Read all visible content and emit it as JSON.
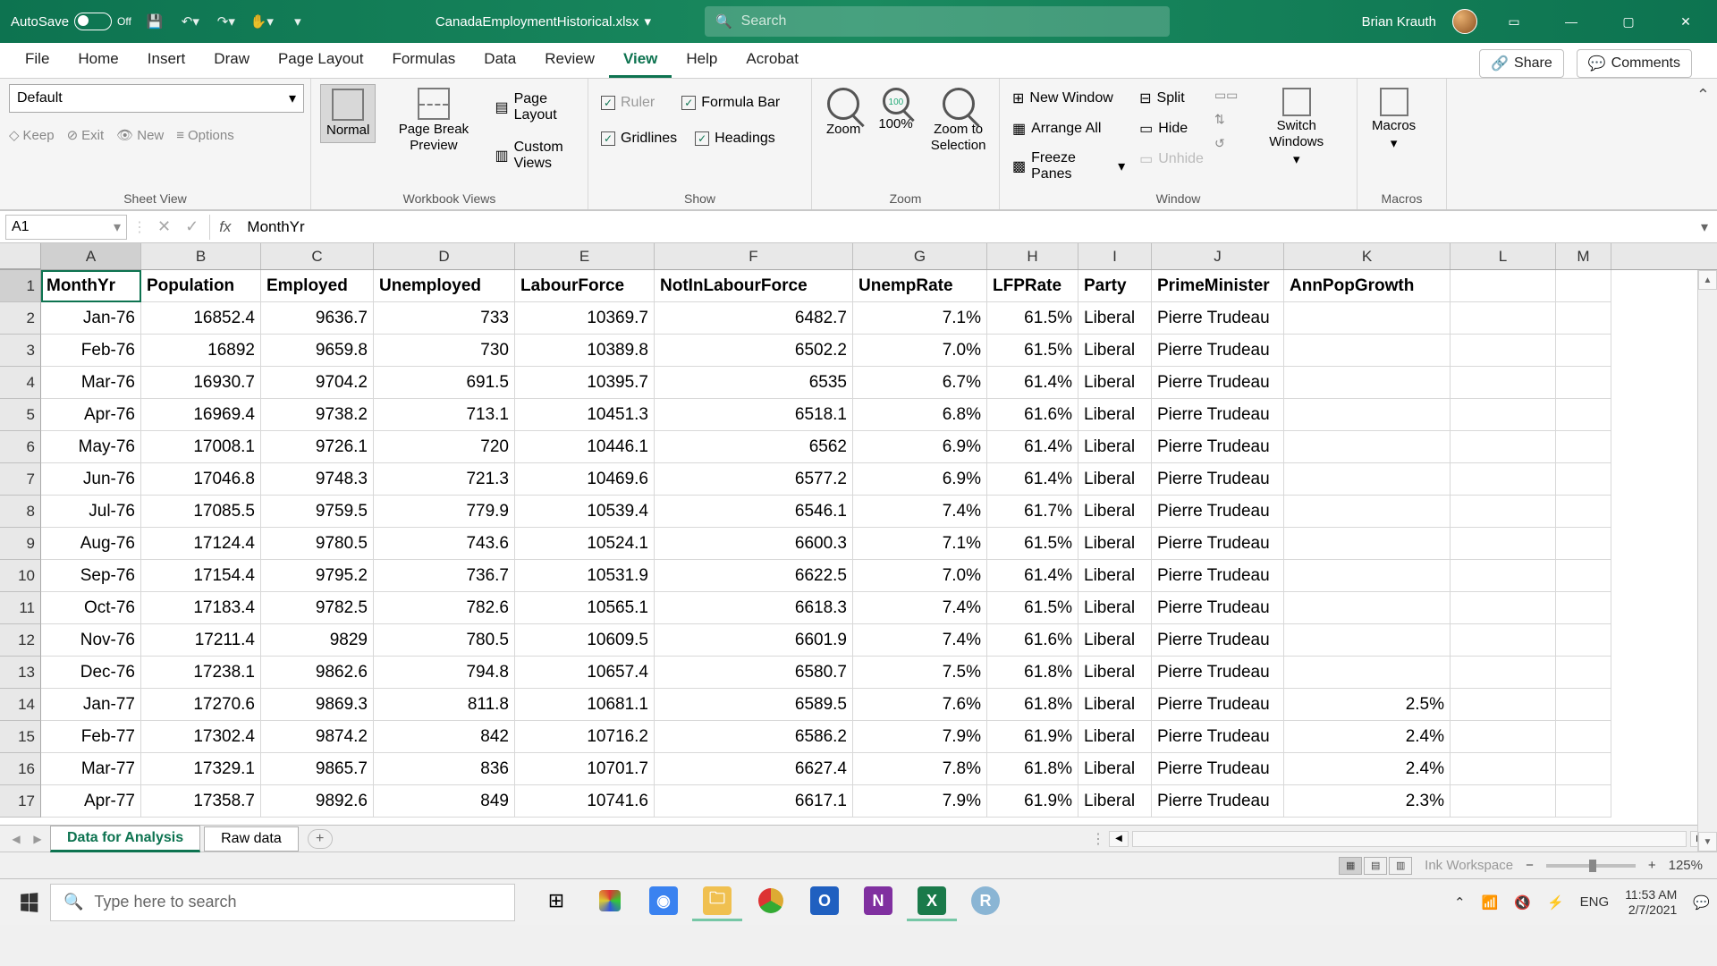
{
  "title_bar": {
    "autosave_label": "AutoSave",
    "autosave_state": "Off",
    "filename": "CanadaEmploymentHistorical.xlsx",
    "search_placeholder": "Search",
    "username": "Brian Krauth"
  },
  "ribbon_tabs": [
    "File",
    "Home",
    "Insert",
    "Draw",
    "Page Layout",
    "Formulas",
    "Data",
    "Review",
    "View",
    "Help",
    "Acrobat"
  ],
  "active_tab": "View",
  "ribbon_right": {
    "share": "Share",
    "comments": "Comments"
  },
  "ribbon": {
    "sheet_view": {
      "default": "Default",
      "keep": "Keep",
      "exit": "Exit",
      "new": "New",
      "options": "Options",
      "label": "Sheet View"
    },
    "workbook_views": {
      "normal": "Normal",
      "page_break": "Page Break Preview",
      "page_layout": "Page Layout",
      "custom": "Custom Views",
      "label": "Workbook Views"
    },
    "show": {
      "ruler": "Ruler",
      "formula_bar": "Formula Bar",
      "gridlines": "Gridlines",
      "headings": "Headings",
      "label": "Show"
    },
    "zoom": {
      "zoom": "Zoom",
      "hundred": "100%",
      "selection": "Zoom to Selection",
      "label": "Zoom"
    },
    "window": {
      "new_window": "New Window",
      "arrange": "Arrange All",
      "freeze": "Freeze Panes",
      "split": "Split",
      "hide": "Hide",
      "unhide": "Unhide",
      "switch": "Switch Windows",
      "label": "Window"
    },
    "macros": {
      "macros": "Macros",
      "label": "Macros"
    }
  },
  "formula_bar": {
    "name_box": "A1",
    "formula": "MonthYr"
  },
  "columns": [
    "A",
    "B",
    "C",
    "D",
    "E",
    "F",
    "G",
    "H",
    "I",
    "J",
    "K",
    "L",
    "M"
  ],
  "headers": [
    "MonthYr",
    "Population",
    "Employed",
    "Unemployed",
    "LabourForce",
    "NotInLabourForce",
    "UnempRate",
    "LFPRate",
    "Party",
    "PrimeMinister",
    "AnnPopGrowth",
    "",
    ""
  ],
  "rows": [
    [
      "Jan-76",
      "16852.4",
      "9636.7",
      "733",
      "10369.7",
      "6482.7",
      "7.1%",
      "61.5%",
      "Liberal",
      "Pierre Trudeau",
      "",
      "",
      ""
    ],
    [
      "Feb-76",
      "16892",
      "9659.8",
      "730",
      "10389.8",
      "6502.2",
      "7.0%",
      "61.5%",
      "Liberal",
      "Pierre Trudeau",
      "",
      "",
      ""
    ],
    [
      "Mar-76",
      "16930.7",
      "9704.2",
      "691.5",
      "10395.7",
      "6535",
      "6.7%",
      "61.4%",
      "Liberal",
      "Pierre Trudeau",
      "",
      "",
      ""
    ],
    [
      "Apr-76",
      "16969.4",
      "9738.2",
      "713.1",
      "10451.3",
      "6518.1",
      "6.8%",
      "61.6%",
      "Liberal",
      "Pierre Trudeau",
      "",
      "",
      ""
    ],
    [
      "May-76",
      "17008.1",
      "9726.1",
      "720",
      "10446.1",
      "6562",
      "6.9%",
      "61.4%",
      "Liberal",
      "Pierre Trudeau",
      "",
      "",
      ""
    ],
    [
      "Jun-76",
      "17046.8",
      "9748.3",
      "721.3",
      "10469.6",
      "6577.2",
      "6.9%",
      "61.4%",
      "Liberal",
      "Pierre Trudeau",
      "",
      "",
      ""
    ],
    [
      "Jul-76",
      "17085.5",
      "9759.5",
      "779.9",
      "10539.4",
      "6546.1",
      "7.4%",
      "61.7%",
      "Liberal",
      "Pierre Trudeau",
      "",
      "",
      ""
    ],
    [
      "Aug-76",
      "17124.4",
      "9780.5",
      "743.6",
      "10524.1",
      "6600.3",
      "7.1%",
      "61.5%",
      "Liberal",
      "Pierre Trudeau",
      "",
      "",
      ""
    ],
    [
      "Sep-76",
      "17154.4",
      "9795.2",
      "736.7",
      "10531.9",
      "6622.5",
      "7.0%",
      "61.4%",
      "Liberal",
      "Pierre Trudeau",
      "",
      "",
      ""
    ],
    [
      "Oct-76",
      "17183.4",
      "9782.5",
      "782.6",
      "10565.1",
      "6618.3",
      "7.4%",
      "61.5%",
      "Liberal",
      "Pierre Trudeau",
      "",
      "",
      ""
    ],
    [
      "Nov-76",
      "17211.4",
      "9829",
      "780.5",
      "10609.5",
      "6601.9",
      "7.4%",
      "61.6%",
      "Liberal",
      "Pierre Trudeau",
      "",
      "",
      ""
    ],
    [
      "Dec-76",
      "17238.1",
      "9862.6",
      "794.8",
      "10657.4",
      "6580.7",
      "7.5%",
      "61.8%",
      "Liberal",
      "Pierre Trudeau",
      "",
      "",
      ""
    ],
    [
      "Jan-77",
      "17270.6",
      "9869.3",
      "811.8",
      "10681.1",
      "6589.5",
      "7.6%",
      "61.8%",
      "Liberal",
      "Pierre Trudeau",
      "2.5%",
      "",
      ""
    ],
    [
      "Feb-77",
      "17302.4",
      "9874.2",
      "842",
      "10716.2",
      "6586.2",
      "7.9%",
      "61.9%",
      "Liberal",
      "Pierre Trudeau",
      "2.4%",
      "",
      ""
    ],
    [
      "Mar-77",
      "17329.1",
      "9865.7",
      "836",
      "10701.7",
      "6627.4",
      "7.8%",
      "61.8%",
      "Liberal",
      "Pierre Trudeau",
      "2.4%",
      "",
      ""
    ],
    [
      "Apr-77",
      "17358.7",
      "9892.6",
      "849",
      "10741.6",
      "6617.1",
      "7.9%",
      "61.9%",
      "Liberal",
      "Pierre Trudeau",
      "2.3%",
      "",
      ""
    ]
  ],
  "right_align_cols": [
    0,
    1,
    2,
    3,
    4,
    5,
    6,
    7,
    10
  ],
  "sheet_tabs": {
    "active": "Data for Analysis",
    "others": [
      "Raw data"
    ]
  },
  "status_bar": {
    "workspace_text": "Ink Workspace",
    "zoom": "125%"
  },
  "taskbar": {
    "search_placeholder": "Type here to search",
    "lang": "ENG",
    "time": "11:53 AM",
    "date": "2/7/2021"
  }
}
